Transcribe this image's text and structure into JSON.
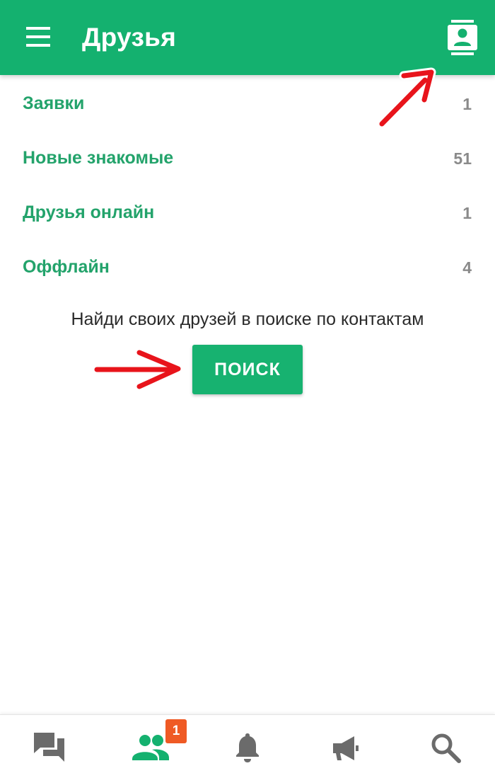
{
  "appbar": {
    "title": "Друзья",
    "menu_icon": "hamburger-menu-icon",
    "contacts_icon": "contact-card-icon",
    "background_color": "#14b16f"
  },
  "categories": [
    {
      "label": "Заявки",
      "count": "1"
    },
    {
      "label": "Новые знакомые",
      "count": "51"
    },
    {
      "label": "Друзья онлайн",
      "count": "1"
    },
    {
      "label": "Оффлайн",
      "count": "4"
    }
  ],
  "hint": {
    "text": "Найди своих друзей в поиске по контактам",
    "button_label": "ПОИСК"
  },
  "bottom_nav": {
    "items": [
      {
        "icon": "chat-icon",
        "active": false
      },
      {
        "icon": "friends-icon",
        "active": true,
        "badge": "1"
      },
      {
        "icon": "bell-icon",
        "active": false
      },
      {
        "icon": "megaphone-icon",
        "active": false
      },
      {
        "icon": "search-icon",
        "active": false
      }
    ],
    "active_color": "#14b16f",
    "inactive_color": "#6b6b6b",
    "badge_color": "#ef5a24"
  },
  "annotations": {
    "arrow_color": "#e8141b"
  }
}
